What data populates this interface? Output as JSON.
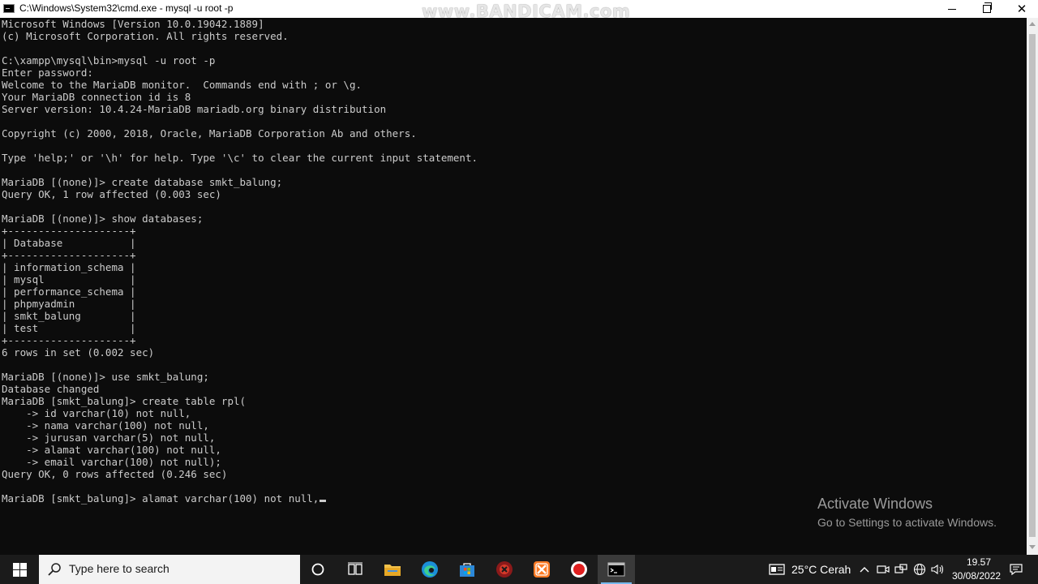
{
  "window": {
    "title": "C:\\Windows\\System32\\cmd.exe - mysql  -u root -p",
    "watermark": "www.BANDICAM.com",
    "close_glyph": "✕"
  },
  "console": {
    "lines": [
      "Microsoft Windows [Version 10.0.19042.1889]",
      "(c) Microsoft Corporation. All rights reserved.",
      "",
      "C:\\xampp\\mysql\\bin>mysql -u root -p",
      "Enter password:",
      "Welcome to the MariaDB monitor.  Commands end with ; or \\g.",
      "Your MariaDB connection id is 8",
      "Server version: 10.4.24-MariaDB mariadb.org binary distribution",
      "",
      "Copyright (c) 2000, 2018, Oracle, MariaDB Corporation Ab and others.",
      "",
      "Type 'help;' or '\\h' for help. Type '\\c' to clear the current input statement.",
      "",
      "MariaDB [(none)]> create database smkt_balung;",
      "Query OK, 1 row affected (0.003 sec)",
      "",
      "MariaDB [(none)]> show databases;",
      "+--------------------+",
      "| Database           |",
      "+--------------------+",
      "| information_schema |",
      "| mysql              |",
      "| performance_schema |",
      "| phpmyadmin         |",
      "| smkt_balung        |",
      "| test               |",
      "+--------------------+",
      "6 rows in set (0.002 sec)",
      "",
      "MariaDB [(none)]> use smkt_balung;",
      "Database changed",
      "MariaDB [smkt_balung]> create table rpl(",
      "    -> id varchar(10) not null,",
      "    -> nama varchar(100) not null,",
      "    -> jurusan varchar(5) not null,",
      "    -> alamat varchar(100) not null,",
      "    -> email varchar(100) not null);",
      "Query OK, 0 rows affected (0.246 sec)",
      ""
    ],
    "current_input": "MariaDB [smkt_balung]> alamat varchar(100) not null,"
  },
  "activation": {
    "title": "Activate Windows",
    "subtitle": "Go to Settings to activate Windows."
  },
  "taskbar": {
    "search_placeholder": "Type here to search",
    "apps": [
      "cortana-icon",
      "task-view-icon",
      "file-explorer-icon",
      "edge-icon",
      "store-icon",
      "antivirus-icon",
      "xampp-icon",
      "bandicam-icon",
      "cmd-icon"
    ],
    "weather": "25°C  Cerah",
    "time": "19.57",
    "date": "30/08/2022"
  },
  "colors": {
    "console_bg": "#0c0c0c",
    "console_text": "#cccccc",
    "taskbar_bg": "#1b1b1b",
    "active_indicator": "#76b9ed"
  }
}
